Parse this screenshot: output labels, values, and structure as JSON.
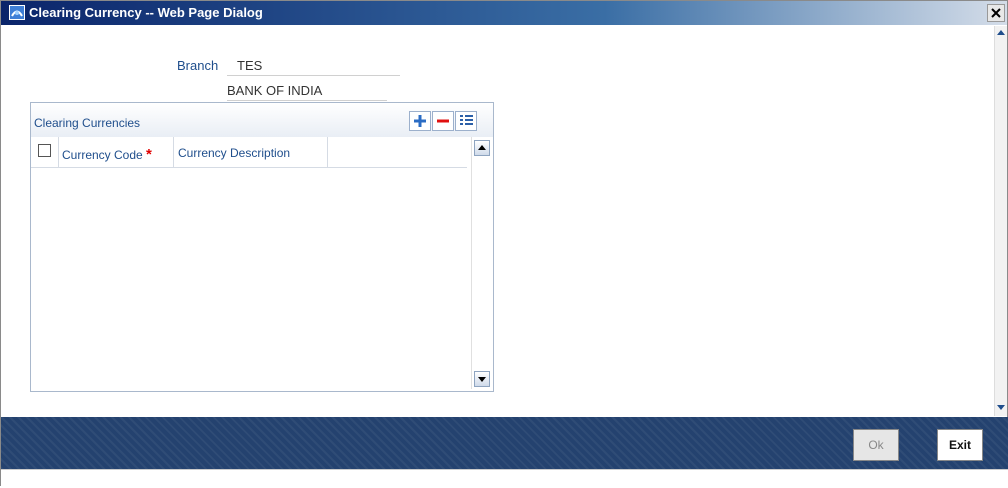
{
  "window": {
    "title": "Clearing Currency -- Web Page Dialog",
    "close_glyph": "×"
  },
  "form": {
    "branch_label": "Branch",
    "branch_code": "TES",
    "branch_name": "BANK OF INDIA"
  },
  "grid": {
    "title": "Clearing Currencies",
    "add_icon": "plus-icon",
    "delete_icon": "minus-icon",
    "view_icon": "list-icon",
    "columns": [
      {
        "label": "Currency Code",
        "required": true,
        "required_mark": "*"
      },
      {
        "label": "Currency Description",
        "required": false
      }
    ],
    "rows": []
  },
  "footer": {
    "ok_label": "Ok",
    "exit_label": "Exit"
  },
  "colors": {
    "accent_text": "#1f4e8c",
    "footer_bg": "#24426f",
    "required": "#e00000"
  }
}
